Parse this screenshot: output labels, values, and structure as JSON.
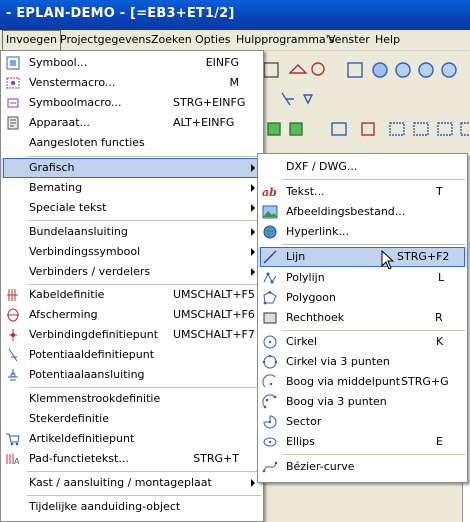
{
  "window": {
    "title": "- EPLAN-DEMO - [=EB3+ET1/2]"
  },
  "menubar": [
    "Invoegen",
    "Projectgegevens",
    "Zoeken",
    "Opties",
    "Hulpprogramma's",
    "Venster",
    "Help"
  ],
  "menu_invoegen": {
    "items": [
      {
        "label": "Symbool...",
        "shortcut": "EINFG",
        "icon": "symbol-icon"
      },
      {
        "label": "Venstermacro...",
        "shortcut": "M",
        "icon": "window-macro-icon"
      },
      {
        "label": "Symboolmacro...",
        "shortcut": "STRG+EINFG",
        "icon": "symbol-macro-icon"
      },
      {
        "label": "Apparaat...",
        "shortcut": "ALT+EINFG",
        "icon": "device-icon"
      },
      {
        "label": "Aangesloten functies",
        "shortcut": "",
        "icon": ""
      },
      {
        "label": "Grafisch",
        "submenu": true
      },
      {
        "label": "Bemating",
        "submenu": true
      },
      {
        "label": "Speciale tekst",
        "submenu": true
      },
      {
        "label": "Bundelaansluiting",
        "submenu": true
      },
      {
        "label": "Verbindingssymbool",
        "submenu": true
      },
      {
        "label": "Verbinders / verdelers",
        "submenu": true
      },
      {
        "label": "Kabeldefinitie",
        "shortcut": "UMSCHALT+F5",
        "icon": "cable-icon"
      },
      {
        "label": "Afscherming",
        "shortcut": "UMSCHALT+F6",
        "icon": "shield-icon"
      },
      {
        "label": "Verbindingdefinitiepunt",
        "shortcut": "UMSCHALT+F7",
        "icon": "connection-point-icon"
      },
      {
        "label": "Potentiaaldefinitiepunt",
        "shortcut": "",
        "icon": "potential-point-icon"
      },
      {
        "label": "Potentiaalaansluiting",
        "shortcut": "",
        "icon": "potential-connection-icon"
      },
      {
        "label": "Klemmenstrookdefinitie",
        "shortcut": ""
      },
      {
        "label": "Stekerdefinitie",
        "shortcut": ""
      },
      {
        "label": "Artikeldefinitiepunt",
        "shortcut": "",
        "icon": "cart-icon"
      },
      {
        "label": "Pad-functietekst...",
        "shortcut": "STRG+T",
        "icon": "pad-text-icon"
      },
      {
        "label": "Kast / aansluiting / montageplaat",
        "submenu": true
      },
      {
        "label": "Tijdelijke aanduiding-object",
        "shortcut": ""
      }
    ]
  },
  "menu_grafisch": {
    "items": [
      {
        "label": "DXF / DWG...",
        "shortcut": ""
      },
      {
        "label": "Tekst...",
        "shortcut": "T",
        "icon": "text-icon"
      },
      {
        "label": "Afbeeldingsbestand...",
        "shortcut": "",
        "icon": "image-icon"
      },
      {
        "label": "Hyperlink...",
        "shortcut": "",
        "icon": "globe-icon"
      },
      {
        "label": "Lijn",
        "shortcut": "STRG+F2",
        "icon": "line-icon"
      },
      {
        "label": "Polylijn",
        "shortcut": "L",
        "icon": "polyline-icon"
      },
      {
        "label": "Polygoon",
        "shortcut": "",
        "icon": "polygon-icon"
      },
      {
        "label": "Rechthoek",
        "shortcut": "R",
        "icon": "rectangle-icon"
      },
      {
        "label": "Cirkel",
        "shortcut": "K",
        "icon": "circle-icon"
      },
      {
        "label": "Cirkel via 3 punten",
        "shortcut": "",
        "icon": "circle3-icon"
      },
      {
        "label": "Boog via middelpunt",
        "shortcut": "STRG+G",
        "icon": "arc-icon"
      },
      {
        "label": "Boog via 3 punten",
        "shortcut": "",
        "icon": "arc3-icon"
      },
      {
        "label": "Sector",
        "shortcut": "",
        "icon": "sector-icon"
      },
      {
        "label": "Ellips",
        "shortcut": "E",
        "icon": "ellipse-icon"
      },
      {
        "label": "Bézier-curve",
        "shortcut": "",
        "icon": "bezier-icon"
      }
    ]
  }
}
